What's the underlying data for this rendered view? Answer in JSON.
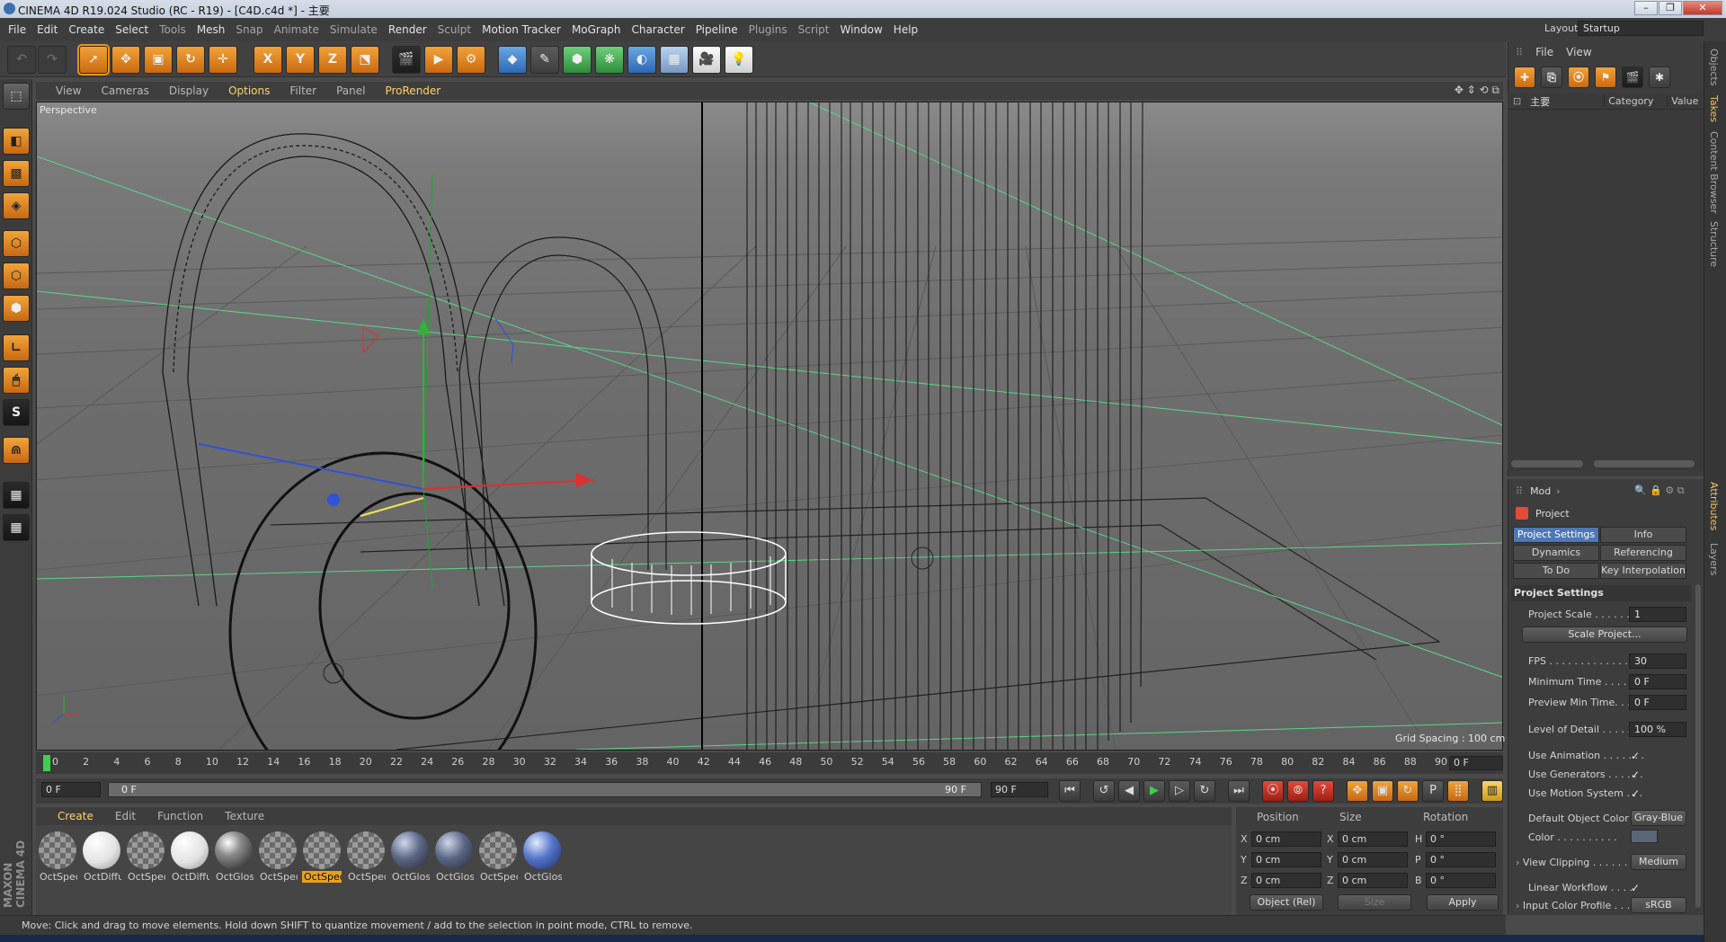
{
  "window": {
    "title": "CINEMA 4D R19.024 Studio (RC - R19) - [C4D.c4d *] - 主要",
    "buttons": [
      "–",
      "❐",
      "✕"
    ]
  },
  "menubar": {
    "items": [
      "File",
      "Edit",
      "Create",
      "Select",
      "Tools",
      "Mesh",
      "Snap",
      "Animate",
      "Simulate",
      "Render",
      "Sculpt",
      "Motion Tracker",
      "MoGraph",
      "Character",
      "Pipeline",
      "Plugins",
      "Script",
      "Window",
      "Help"
    ],
    "layout_label": "Layout:",
    "layout_value": "Startup"
  },
  "toolbar": {
    "icons": [
      "undo-icon",
      "redo-icon",
      "select-icon",
      "move-icon",
      "scale-icon",
      "rotate-icon",
      "live-move-icon",
      "x-axis-icon",
      "y-axis-icon",
      "z-axis-icon",
      "coordinate-system-icon",
      "render-view-icon",
      "render-picture-viewer-icon",
      "render-settings-icon",
      "cube-icon",
      "pen-icon",
      "subdivision-icon",
      "cloner-icon",
      "deformer-icon",
      "floor-icon",
      "camera-icon",
      "light-icon"
    ],
    "axis_labels": [
      "X",
      "Y",
      "Z"
    ]
  },
  "viewport": {
    "menu": [
      "View",
      "Cameras",
      "Display",
      "Options",
      "Filter",
      "Panel",
      "ProRender"
    ],
    "label": "Perspective",
    "grid_spacing": "Grid Spacing : 100 cm"
  },
  "timeline": {
    "ticks": [
      "0",
      "2",
      "4",
      "6",
      "8",
      "10",
      "12",
      "14",
      "16",
      "18",
      "20",
      "22",
      "24",
      "26",
      "28",
      "30",
      "32",
      "34",
      "36",
      "38",
      "40",
      "42",
      "44",
      "46",
      "48",
      "50",
      "52",
      "54",
      "56",
      "58",
      "60",
      "62",
      "64",
      "66",
      "68",
      "70",
      "72",
      "74",
      "76",
      "78",
      "80",
      "82",
      "84",
      "86",
      "88",
      "90"
    ],
    "current_frame": "0 F",
    "start_field": "0 F",
    "slider_left": "0 F",
    "slider_right": "90 F",
    "end_field": "90 F"
  },
  "materials": {
    "menu": [
      "Create",
      "Edit",
      "Function",
      "Texture"
    ],
    "items": [
      {
        "label": "OctSpec",
        "style": "check"
      },
      {
        "label": "OctDiffu",
        "style": "white"
      },
      {
        "label": "OctSpec",
        "style": "check"
      },
      {
        "label": "OctDiffu",
        "style": "white"
      },
      {
        "label": "OctGloss",
        "style": "gloss"
      },
      {
        "label": "OctSpec",
        "style": "check"
      },
      {
        "label": "OctSpec",
        "style": "check",
        "selected": true
      },
      {
        "label": "OctSpec",
        "style": "check"
      },
      {
        "label": "OctGloss",
        "style": "navy"
      },
      {
        "label": "OctGloss",
        "style": "navy"
      },
      {
        "label": "OctSpec",
        "style": "check"
      },
      {
        "label": "OctGloss",
        "style": "blue"
      }
    ]
  },
  "coordinates": {
    "headers": [
      "Position",
      "Size",
      "Rotation"
    ],
    "rows": [
      {
        "pos_axis": "X",
        "pos": "0 cm",
        "size_axis": "X",
        "size": "0 cm",
        "rot_axis": "H",
        "rot": "0 °"
      },
      {
        "pos_axis": "Y",
        "pos": "0 cm",
        "size_axis": "Y",
        "size": "0 cm",
        "rot_axis": "P",
        "rot": "0 °"
      },
      {
        "pos_axis": "Z",
        "pos": "0 cm",
        "size_axis": "Z",
        "size": "0 cm",
        "rot_axis": "B",
        "rot": "0 °"
      }
    ],
    "mode": "Object (Rel)",
    "size_mode": "Size",
    "apply": "Apply"
  },
  "status": "Move: Click and drag to move elements. Hold down SHIFT to quantize movement / add to the selection in point mode, CTRL to remove.",
  "objects_panel": {
    "menu": [
      "File",
      "View"
    ],
    "tree_item": "主要",
    "columns": [
      "Category",
      "Value"
    ]
  },
  "right_tabs": [
    "Objects",
    "Takes",
    "Content Browser",
    "Structure",
    "Attributes",
    "Layers"
  ],
  "attributes": {
    "mode": "Mod",
    "title": "Project",
    "tabs": [
      "Project Settings",
      "Info",
      "Dynamics",
      "Referencing",
      "To Do",
      "Key Interpolation"
    ],
    "section": "Project Settings",
    "project_scale_label": "Project Scale . . . . . . .",
    "project_scale": "1",
    "scale_button": "Scale Project...",
    "fps_label": "FPS . . . . . . . . . . . . . .",
    "fps": "30",
    "min_time_label": "Minimum Time . . . . . .",
    "min_time": "0 F",
    "preview_min_label": "Preview Min Time. . . .",
    "preview_min": "0 F",
    "lod_label": "Level of Detail . . . . . .",
    "lod": "100 %",
    "use_animation": "Use Animation . . . . . . .",
    "use_generators": "Use Generators . . . . . .",
    "use_motion": "Use Motion System . . .",
    "default_color_label": "Default Object Color",
    "default_color": "Gray-Blue",
    "color_label": "Color . . . . . . . . . .",
    "view_clipping_label": "View Clipping . . . . . . .",
    "view_clipping": "Medium",
    "linear_workflow": "Linear Workflow . . . .",
    "input_color_label": "Input Color Profile . . .",
    "input_color": "sRGB",
    "check": "✓"
  },
  "colors": {
    "accent": "#e8a020",
    "selection_blue": "#4d78b5",
    "grid_line": "#5a5a5a",
    "green_line": "#5dd48a"
  }
}
